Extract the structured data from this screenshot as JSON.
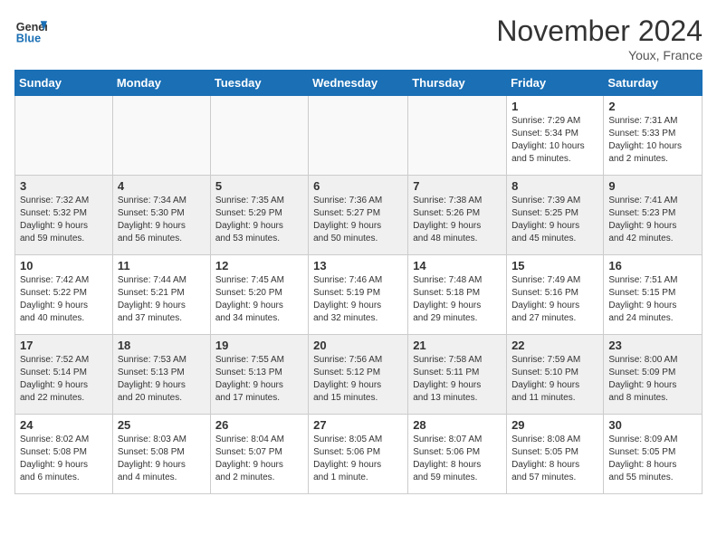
{
  "header": {
    "logo_line1": "General",
    "logo_line2": "Blue",
    "month_title": "November 2024",
    "location": "Youx, France"
  },
  "weekdays": [
    "Sunday",
    "Monday",
    "Tuesday",
    "Wednesday",
    "Thursday",
    "Friday",
    "Saturday"
  ],
  "weeks": [
    [
      {
        "day": "",
        "info": ""
      },
      {
        "day": "",
        "info": ""
      },
      {
        "day": "",
        "info": ""
      },
      {
        "day": "",
        "info": ""
      },
      {
        "day": "",
        "info": ""
      },
      {
        "day": "1",
        "info": "Sunrise: 7:29 AM\nSunset: 5:34 PM\nDaylight: 10 hours\nand 5 minutes."
      },
      {
        "day": "2",
        "info": "Sunrise: 7:31 AM\nSunset: 5:33 PM\nDaylight: 10 hours\nand 2 minutes."
      }
    ],
    [
      {
        "day": "3",
        "info": "Sunrise: 7:32 AM\nSunset: 5:32 PM\nDaylight: 9 hours\nand 59 minutes."
      },
      {
        "day": "4",
        "info": "Sunrise: 7:34 AM\nSunset: 5:30 PM\nDaylight: 9 hours\nand 56 minutes."
      },
      {
        "day": "5",
        "info": "Sunrise: 7:35 AM\nSunset: 5:29 PM\nDaylight: 9 hours\nand 53 minutes."
      },
      {
        "day": "6",
        "info": "Sunrise: 7:36 AM\nSunset: 5:27 PM\nDaylight: 9 hours\nand 50 minutes."
      },
      {
        "day": "7",
        "info": "Sunrise: 7:38 AM\nSunset: 5:26 PM\nDaylight: 9 hours\nand 48 minutes."
      },
      {
        "day": "8",
        "info": "Sunrise: 7:39 AM\nSunset: 5:25 PM\nDaylight: 9 hours\nand 45 minutes."
      },
      {
        "day": "9",
        "info": "Sunrise: 7:41 AM\nSunset: 5:23 PM\nDaylight: 9 hours\nand 42 minutes."
      }
    ],
    [
      {
        "day": "10",
        "info": "Sunrise: 7:42 AM\nSunset: 5:22 PM\nDaylight: 9 hours\nand 40 minutes."
      },
      {
        "day": "11",
        "info": "Sunrise: 7:44 AM\nSunset: 5:21 PM\nDaylight: 9 hours\nand 37 minutes."
      },
      {
        "day": "12",
        "info": "Sunrise: 7:45 AM\nSunset: 5:20 PM\nDaylight: 9 hours\nand 34 minutes."
      },
      {
        "day": "13",
        "info": "Sunrise: 7:46 AM\nSunset: 5:19 PM\nDaylight: 9 hours\nand 32 minutes."
      },
      {
        "day": "14",
        "info": "Sunrise: 7:48 AM\nSunset: 5:18 PM\nDaylight: 9 hours\nand 29 minutes."
      },
      {
        "day": "15",
        "info": "Sunrise: 7:49 AM\nSunset: 5:16 PM\nDaylight: 9 hours\nand 27 minutes."
      },
      {
        "day": "16",
        "info": "Sunrise: 7:51 AM\nSunset: 5:15 PM\nDaylight: 9 hours\nand 24 minutes."
      }
    ],
    [
      {
        "day": "17",
        "info": "Sunrise: 7:52 AM\nSunset: 5:14 PM\nDaylight: 9 hours\nand 22 minutes."
      },
      {
        "day": "18",
        "info": "Sunrise: 7:53 AM\nSunset: 5:13 PM\nDaylight: 9 hours\nand 20 minutes."
      },
      {
        "day": "19",
        "info": "Sunrise: 7:55 AM\nSunset: 5:13 PM\nDaylight: 9 hours\nand 17 minutes."
      },
      {
        "day": "20",
        "info": "Sunrise: 7:56 AM\nSunset: 5:12 PM\nDaylight: 9 hours\nand 15 minutes."
      },
      {
        "day": "21",
        "info": "Sunrise: 7:58 AM\nSunset: 5:11 PM\nDaylight: 9 hours\nand 13 minutes."
      },
      {
        "day": "22",
        "info": "Sunrise: 7:59 AM\nSunset: 5:10 PM\nDaylight: 9 hours\nand 11 minutes."
      },
      {
        "day": "23",
        "info": "Sunrise: 8:00 AM\nSunset: 5:09 PM\nDaylight: 9 hours\nand 8 minutes."
      }
    ],
    [
      {
        "day": "24",
        "info": "Sunrise: 8:02 AM\nSunset: 5:08 PM\nDaylight: 9 hours\nand 6 minutes."
      },
      {
        "day": "25",
        "info": "Sunrise: 8:03 AM\nSunset: 5:08 PM\nDaylight: 9 hours\nand 4 minutes."
      },
      {
        "day": "26",
        "info": "Sunrise: 8:04 AM\nSunset: 5:07 PM\nDaylight: 9 hours\nand 2 minutes."
      },
      {
        "day": "27",
        "info": "Sunrise: 8:05 AM\nSunset: 5:06 PM\nDaylight: 9 hours\nand 1 minute."
      },
      {
        "day": "28",
        "info": "Sunrise: 8:07 AM\nSunset: 5:06 PM\nDaylight: 8 hours\nand 59 minutes."
      },
      {
        "day": "29",
        "info": "Sunrise: 8:08 AM\nSunset: 5:05 PM\nDaylight: 8 hours\nand 57 minutes."
      },
      {
        "day": "30",
        "info": "Sunrise: 8:09 AM\nSunset: 5:05 PM\nDaylight: 8 hours\nand 55 minutes."
      }
    ]
  ]
}
